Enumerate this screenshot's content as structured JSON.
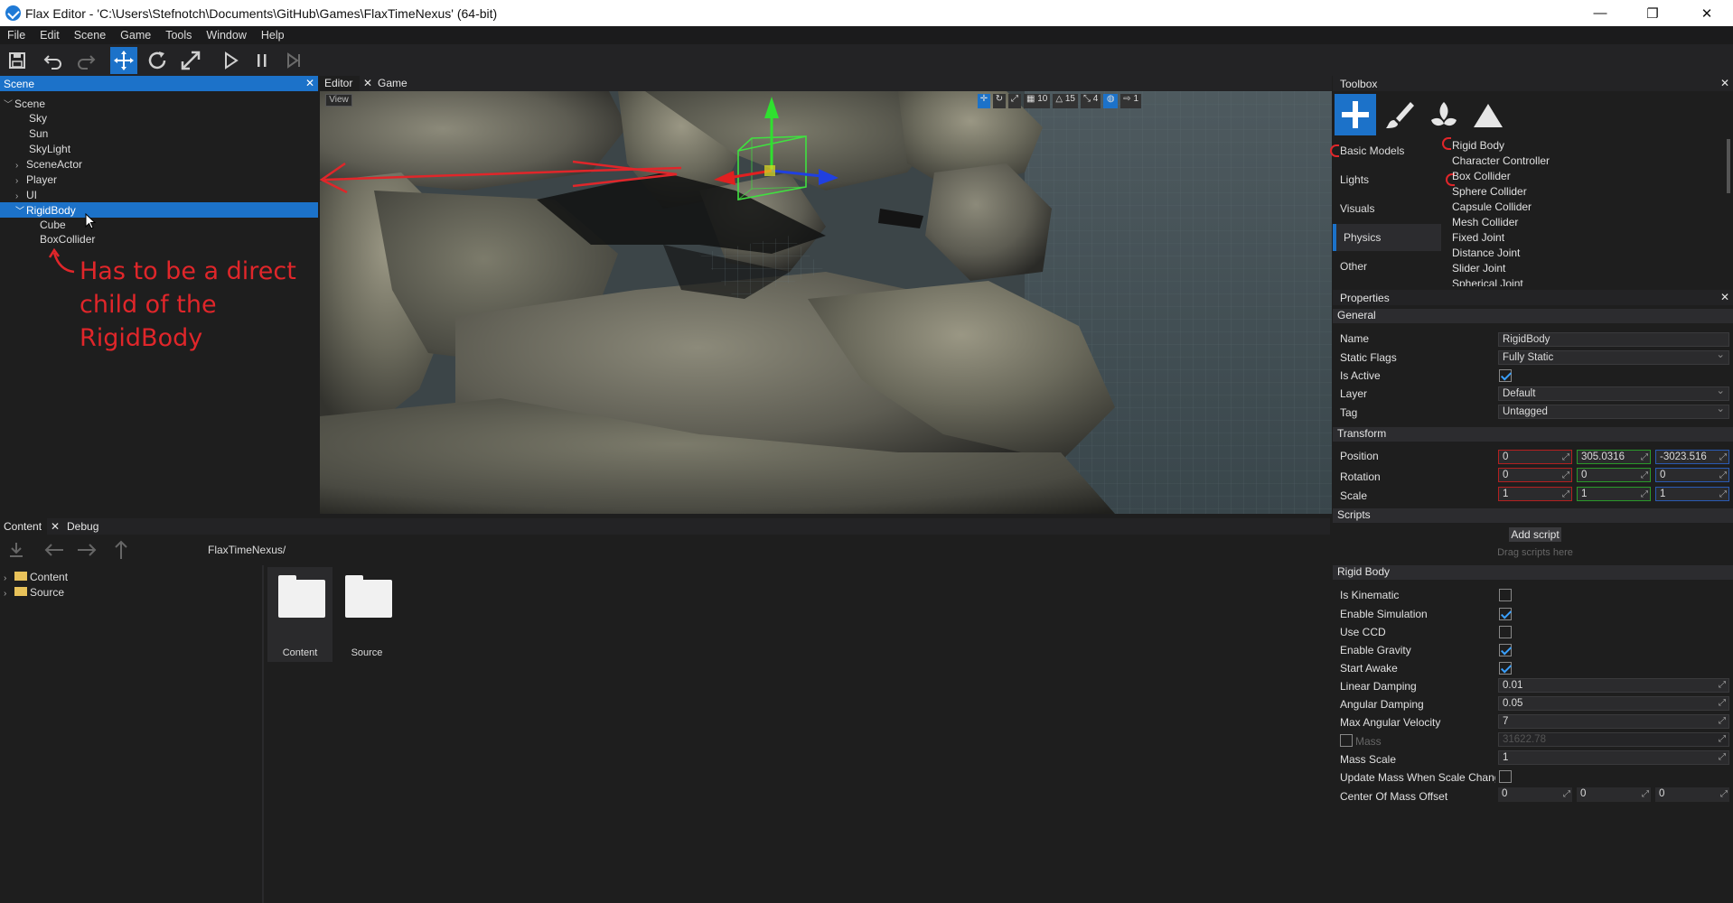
{
  "window": {
    "title": "Flax Editor - 'C:\\Users\\Stefnotch\\Documents\\GitHub\\Games\\FlaxTimeNexus' (64-bit)",
    "minimize": "—",
    "restore": "❐",
    "close": "✕"
  },
  "menu": [
    "File",
    "Edit",
    "Scene",
    "Game",
    "Tools",
    "Window",
    "Help"
  ],
  "scene_panel": {
    "tab": "Scene",
    "close": "✕",
    "tree": [
      {
        "label": "Scene",
        "expanded": true
      },
      {
        "label": "Sky"
      },
      {
        "label": "Sun"
      },
      {
        "label": "SkyLight"
      },
      {
        "label": "SceneActor",
        "collapsed": true
      },
      {
        "label": "Player",
        "collapsed": true
      },
      {
        "label": "UI",
        "collapsed": true
      },
      {
        "label": "RigidBody",
        "expanded": true,
        "selected": true
      },
      {
        "label": "Cube"
      },
      {
        "label": "BoxCollider"
      }
    ],
    "annotation": [
      "Has to be a direct",
      "child of the",
      "RigidBody"
    ]
  },
  "viewport": {
    "tabs": [
      "Editor",
      "Game"
    ],
    "view_button": "View",
    "stats": [
      "10",
      "15",
      "4",
      "1"
    ]
  },
  "content_panel": {
    "tabs": [
      "Content",
      "Debug"
    ],
    "path": "FlaxTimeNexus/",
    "tree": [
      "Content",
      "Source"
    ],
    "items": [
      "Content",
      "Source"
    ]
  },
  "toolbox": {
    "title": "Toolbox",
    "categories": [
      "Basic Models",
      "Lights",
      "Visuals",
      "Physics",
      "Other"
    ],
    "selected_category": "Physics",
    "items": [
      "Rigid Body",
      "Character Controller",
      "Box Collider",
      "Sphere Collider",
      "Capsule Collider",
      "Mesh Collider",
      "Fixed Joint",
      "Distance Joint",
      "Slider Joint",
      "Spherical Joint"
    ]
  },
  "properties": {
    "title": "Properties",
    "general": {
      "header": "General",
      "name_label": "Name",
      "name": "RigidBody",
      "static_flags_label": "Static Flags",
      "static_flags": "Fully Static",
      "is_active_label": "Is Active",
      "layer_label": "Layer",
      "layer": "Default",
      "tag_label": "Tag",
      "tag": "Untagged"
    },
    "transform": {
      "header": "Transform",
      "position_label": "Position",
      "position": [
        "0",
        "305.0316",
        "-3023.516"
      ],
      "rotation_label": "Rotation",
      "rotation": [
        "0",
        "0",
        "0"
      ],
      "scale_label": "Scale",
      "scale": [
        "1",
        "1",
        "1"
      ]
    },
    "scripts": {
      "header": "Scripts",
      "add": "Add script",
      "hint": "Drag scripts here"
    },
    "rigid_body": {
      "header": "Rigid Body",
      "is_kinematic": "Is Kinematic",
      "enable_simulation": "Enable Simulation",
      "use_ccd": "Use CCD",
      "enable_gravity": "Enable Gravity",
      "start_awake": "Start Awake",
      "linear_damping_label": "Linear Damping",
      "linear_damping": "0.01",
      "angular_damping_label": "Angular Damping",
      "angular_damping": "0.05",
      "max_angular_velocity_label": "Max Angular Velocity",
      "max_angular_velocity": "7",
      "mass_label": "Mass",
      "mass": "31622.78",
      "mass_scale_label": "Mass Scale",
      "mass_scale": "1",
      "update_mass_label": "Update Mass When Scale Change",
      "com_offset_label": "Center Of Mass Offset",
      "com_offset": [
        "0",
        "0",
        "0"
      ]
    }
  },
  "colors": {
    "accent": "#1c72c9",
    "annotation": "#e0262a"
  }
}
